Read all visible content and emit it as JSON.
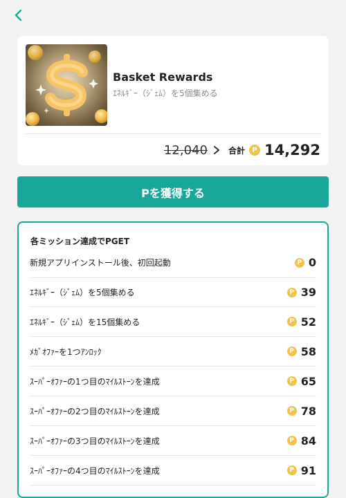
{
  "header": {
    "back_icon": "chevron-left-icon"
  },
  "offer": {
    "title": "Basket Rewards",
    "subtitle": "ｴﾈﾙｷﾞｰ（ｼﾞｪﾑ）を5個集める",
    "old_price": "12,040",
    "total_label": "合計",
    "coin_symbol": "P",
    "total_price": "14,292"
  },
  "cta": {
    "label": "Pを獲得する"
  },
  "missions": {
    "title": "各ミッション達成でPGET",
    "items": [
      {
        "label": "新規アプリインストール後、初回起動",
        "points": "0"
      },
      {
        "label": "ｴﾈﾙｷﾞｰ（ｼﾞｪﾑ）を5個集める",
        "points": "39"
      },
      {
        "label": "ｴﾈﾙｷﾞｰ（ｼﾞｪﾑ）を15個集める",
        "points": "52"
      },
      {
        "label": "ﾒｶﾞｵﾌｧｰを1つｱﾝﾛｯｸ",
        "points": "58"
      },
      {
        "label": "ｽｰﾊﾟｰｵﾌｧｰの1つ目のﾏｲﾙｽﾄｰﾝを達成",
        "points": "65"
      },
      {
        "label": "ｽｰﾊﾟｰｵﾌｧｰの2つ目のﾏｲﾙｽﾄｰﾝを達成",
        "points": "78"
      },
      {
        "label": "ｽｰﾊﾟｰｵﾌｧｰの3つ目のﾏｲﾙｽﾄｰﾝを達成",
        "points": "84"
      },
      {
        "label": "ｽｰﾊﾟｰｵﾌｧｰの4つ目のﾏｲﾙｽﾄｰﾝを達成",
        "points": "91"
      }
    ]
  },
  "colors": {
    "accent": "#17a89a",
    "coin": "#f3c24d",
    "background": "#f2f2f2"
  }
}
